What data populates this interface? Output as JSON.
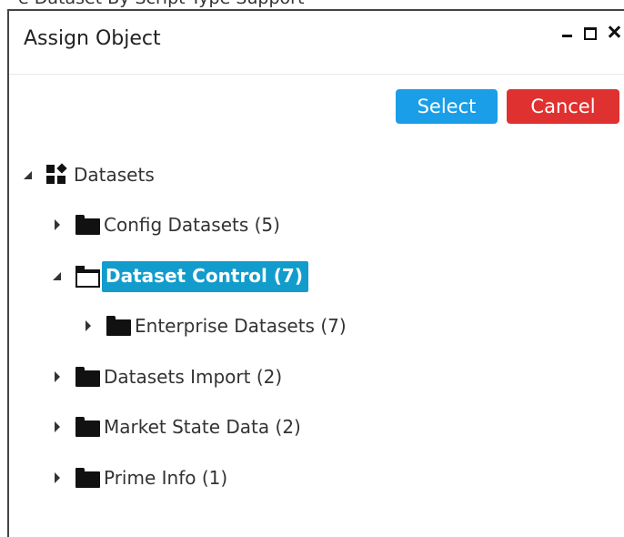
{
  "top_strip_text": "e Dataset  By Script  Type  Support",
  "dialog": {
    "title": "Assign Object",
    "select_label": "Select",
    "cancel_label": "Cancel",
    "colors": {
      "select": "#1a9ee8",
      "cancel": "#e03131",
      "highlight": "#119ccc"
    }
  },
  "tree": {
    "root": {
      "label": "Datasets",
      "icon": "datasets-icon",
      "expanded": true
    },
    "items": [
      {
        "label": "Config Datasets (5)",
        "icon": "folder-icon",
        "expanded": false
      },
      {
        "label": "Dataset Control (7)",
        "icon": "folder-open-icon",
        "expanded": true,
        "selected": true
      },
      {
        "label": "Enterprise Datasets (7)",
        "icon": "folder-icon",
        "expanded": false
      },
      {
        "label": "Datasets Import (2)",
        "icon": "folder-icon",
        "expanded": false
      },
      {
        "label": "Market State Data (2)",
        "icon": "folder-icon",
        "expanded": false
      },
      {
        "label": "Prime Info (1)",
        "icon": "folder-icon",
        "expanded": false
      }
    ]
  }
}
